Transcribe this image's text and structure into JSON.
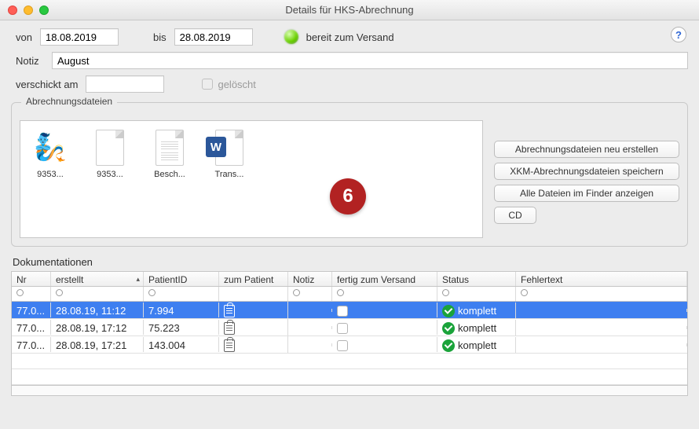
{
  "window": {
    "title": "Details für HKS-Abrechnung"
  },
  "filters": {
    "von_label": "von",
    "von_value": "18.08.2019",
    "bis_label": "bis",
    "bis_value": "28.08.2019",
    "status_text": "bereit zum Versand"
  },
  "notiz": {
    "label": "Notiz",
    "value": "August"
  },
  "verschickt": {
    "label": "verschickt am",
    "value": "",
    "deleted_label": "gelöscht",
    "deleted_checked": false
  },
  "files_group": {
    "title": "Abrechnungsdateien",
    "items": [
      {
        "name": "9353...",
        "icon": "genie-icon"
      },
      {
        "name": "9353...",
        "icon": "blank-page-icon"
      },
      {
        "name": "Besch...",
        "icon": "text-page-icon"
      },
      {
        "name": "Trans...",
        "icon": "word-doc-icon"
      }
    ],
    "buttons": {
      "regen": "Abrechnungsdateien neu erstellen",
      "xkm_save": "XKM-Abrechnungsdateien speichern",
      "show_finder": "Alle Dateien im Finder anzeigen",
      "cd": "CD"
    }
  },
  "badge": "6",
  "docs": {
    "title": "Dokumentationen",
    "columns": {
      "nr": "Nr",
      "erstellt": "erstellt",
      "patient_id": "PatientID",
      "zum_patient": "zum Patient",
      "notiz": "Notiz",
      "fertig": "fertig zum Versand",
      "status": "Status",
      "fehlertext": "Fehlertext"
    },
    "rows": [
      {
        "nr": "77.0...",
        "erstellt": "28.08.19, 11:12",
        "pid": "7.994",
        "status": "komplett",
        "selected": true
      },
      {
        "nr": "77.0...",
        "erstellt": "28.08.19, 17:12",
        "pid": "75.223",
        "status": "komplett",
        "selected": false
      },
      {
        "nr": "77.0...",
        "erstellt": "28.08.19, 17:21",
        "pid": "143.004",
        "status": "komplett",
        "selected": false
      }
    ]
  }
}
